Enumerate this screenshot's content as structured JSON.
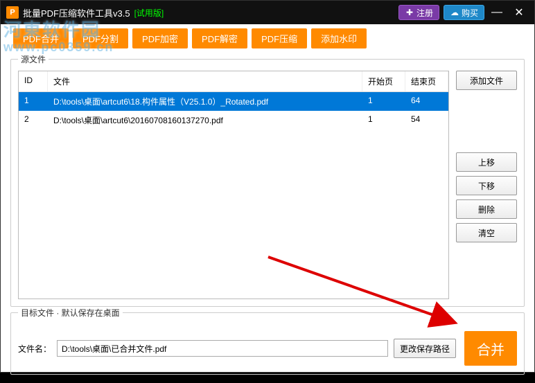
{
  "window": {
    "logo_letter": "P",
    "title": "批量PDF压缩软件工具v3.5",
    "trial": "[试用版]",
    "register": "注册",
    "buy": "购买"
  },
  "watermark": {
    "line1": "河東软件园",
    "url": "www.pc0359.cn"
  },
  "tabs": [
    "PDF合并",
    "PDF分割",
    "PDF加密",
    "PDF解密",
    "PDF压缩",
    "添加水印"
  ],
  "source": {
    "legend": "源文件",
    "headers": {
      "id": "ID",
      "file": "文件",
      "start": "开始页",
      "end": "结束页"
    },
    "rows": [
      {
        "id": "1",
        "file": "D:\\tools\\桌面\\artcut6\\18.构件属性（V25.1.0）_Rotated.pdf",
        "start": "1",
        "end": "64",
        "selected": true
      },
      {
        "id": "2",
        "file": "D:\\tools\\桌面\\artcut6\\20160708160137270.pdf",
        "start": "1",
        "end": "54",
        "selected": false
      }
    ],
    "buttons": {
      "add": "添加文件",
      "up": "上移",
      "down": "下移",
      "del": "删除",
      "clear": "清空"
    }
  },
  "dest": {
    "legend": "目标文件  ·  默认保存在桌面",
    "filename_label": "文件名：",
    "filename_value": "D:\\tools\\桌面\\已合并文件.pdf",
    "change_path": "更改保存路径",
    "merge": "合并"
  }
}
